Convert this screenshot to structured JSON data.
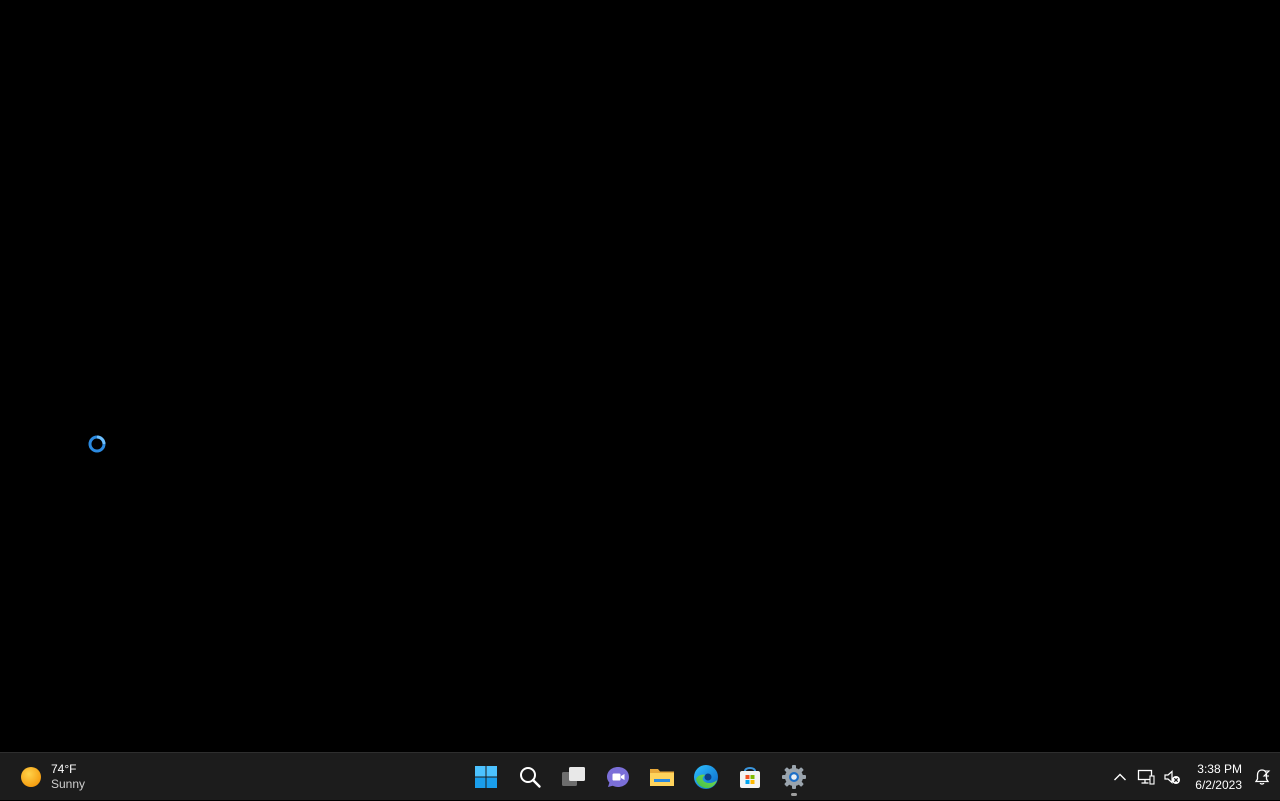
{
  "desktop": {
    "background": "#000000",
    "cursor": "busy-cursor-icon"
  },
  "weather": {
    "temperature": "74°F",
    "condition": "Sunny",
    "icon": "sun-icon"
  },
  "taskbar": {
    "background": "#1c1c1c",
    "apps": [
      {
        "name": "Start",
        "icon": "windows-start-icon"
      },
      {
        "name": "Search",
        "icon": "search-icon"
      },
      {
        "name": "Task View",
        "icon": "task-view-icon"
      },
      {
        "name": "Chat",
        "icon": "teams-chat-icon"
      },
      {
        "name": "File Explorer",
        "icon": "folder-icon"
      },
      {
        "name": "Microsoft Edge",
        "icon": "edge-icon"
      },
      {
        "name": "Microsoft Store",
        "icon": "store-icon"
      },
      {
        "name": "Settings",
        "icon": "settings-gear-icon",
        "running": true
      }
    ]
  },
  "tray": {
    "icons": [
      "chevron-up-icon",
      "network-icon",
      "volume-muted-icon",
      "notification-bell-icon"
    ],
    "time": "3:38 PM",
    "date": "6/2/2023"
  }
}
